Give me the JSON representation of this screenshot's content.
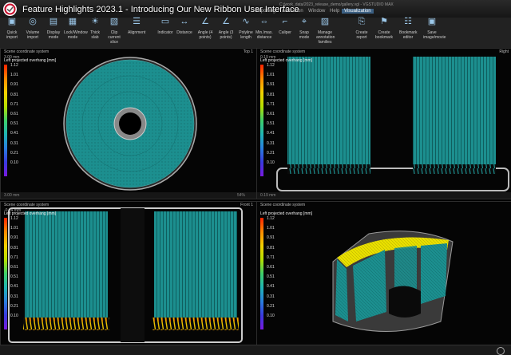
{
  "video_title": "Feature Highlights 2023.1 - Introducing Our New Ribbon User Interface",
  "menu": {
    "items": [
      "Reporting",
      "Animation",
      "Window",
      "Help",
      "Visualization"
    ],
    "active": "Visualization",
    "path": "C:/work_data/2023_release_demo/gallery.vgl - VGSTUDIO MAX"
  },
  "ribbon": [
    {
      "label": "Quick import",
      "icon": "quick-import-icon"
    },
    {
      "label": "Volume import",
      "icon": "volume-import-icon"
    },
    {
      "label": "Display mode",
      "icon": "display-mode-icon"
    },
    {
      "label": "Lock/Window mode",
      "icon": "lock-window-icon"
    },
    {
      "label": "Thick slab",
      "icon": "thick-slab-icon"
    },
    {
      "label": "Clip current slice",
      "icon": "clip-slice-icon"
    },
    {
      "label": "Alignment",
      "icon": "alignment-icon"
    },
    {
      "label": "Indicator",
      "icon": "indicator-icon"
    },
    {
      "label": "Distance",
      "icon": "distance-icon"
    },
    {
      "label": "Angle (4 points)",
      "icon": "angle4-icon"
    },
    {
      "label": "Angle (3 points)",
      "icon": "angle3-icon"
    },
    {
      "label": "Polyline length",
      "icon": "polyline-icon"
    },
    {
      "label": "Min./max. distance",
      "icon": "minmax-icon"
    },
    {
      "label": "Caliper",
      "icon": "caliper-icon"
    },
    {
      "label": "Snap mode",
      "icon": "snap-icon"
    },
    {
      "label": "Manage annotation families",
      "icon": "annotation-icon"
    },
    {
      "label": "Create report",
      "icon": "create-report-icon"
    },
    {
      "label": "Create bookmark",
      "icon": "create-bookmark-icon"
    },
    {
      "label": "Bookmark editor",
      "icon": "bookmark-editor-icon"
    },
    {
      "label": "Save image/movie",
      "icon": "save-image-icon"
    }
  ],
  "legend": {
    "title": "Left projected overhang [mm]",
    "ticks": [
      "1.12",
      "1.01",
      "0.91",
      "0.81",
      "0.71",
      "0.61",
      "0.51",
      "0.41",
      "0.31",
      "0.21",
      "0.10"
    ]
  },
  "viewports": {
    "top": {
      "label": "Scene coordinate system",
      "name": "Top 1",
      "distance": "3.00 mm",
      "scale": "3.00 mm"
    },
    "right": {
      "label": "Scene coordinate system",
      "name": "Right",
      "distance": "0.19 mm",
      "scale": "0.19 mm"
    },
    "front": {
      "label": "Scene coordinate system",
      "name": "Front 1",
      "distance": "-0.14 mm",
      "scale": "-0.14 mm"
    },
    "three_d": {
      "label": "Scene coordinate system",
      "name": "",
      "distance": "",
      "scale": ""
    }
  },
  "zoom": "54%",
  "colors": {
    "teal": "#1c8f8f",
    "yellow": "#e8e000",
    "orange": "#e08a00"
  }
}
